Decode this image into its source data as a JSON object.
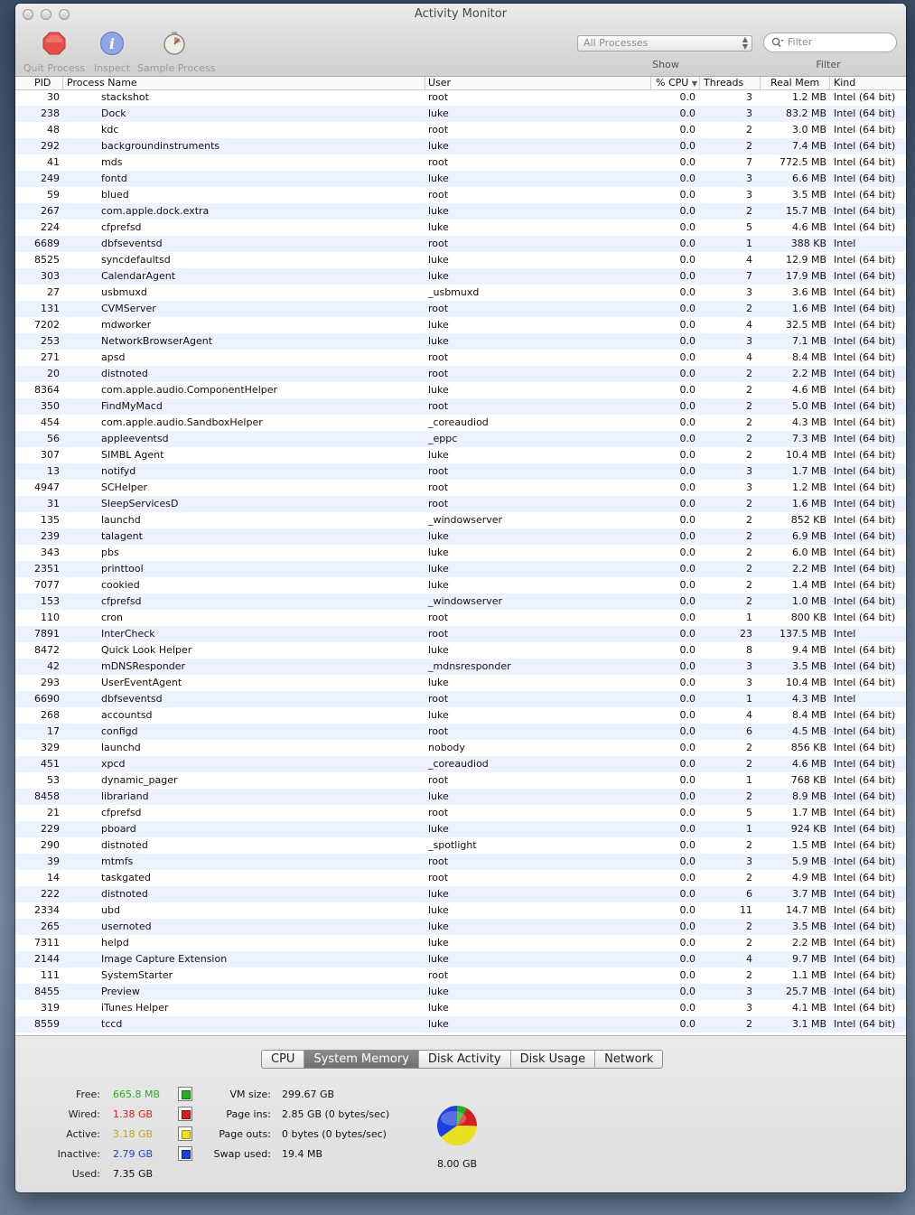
{
  "window": {
    "title": "Activity Monitor"
  },
  "toolbar": {
    "quit_label": "Quit Process",
    "inspect_label": "Inspect",
    "sample_label": "Sample Process",
    "show_label": "Show",
    "filter_label": "Filter",
    "show_value": "All Processes",
    "filter_placeholder": "Filter"
  },
  "columns": {
    "pid": "PID",
    "name": "Process Name",
    "user": "User",
    "cpu": "% CPU",
    "threads": "Threads",
    "mem": "Real Mem",
    "kind": "Kind"
  },
  "processes": [
    [
      "30",
      "stackshot",
      "root",
      "0.0",
      "3",
      "1.2 MB",
      "Intel (64 bit)"
    ],
    [
      "238",
      "Dock",
      "luke",
      "0.0",
      "3",
      "83.2 MB",
      "Intel (64 bit)"
    ],
    [
      "48",
      "kdc",
      "root",
      "0.0",
      "2",
      "3.0 MB",
      "Intel (64 bit)"
    ],
    [
      "292",
      "backgroundinstruments",
      "luke",
      "0.0",
      "2",
      "7.4 MB",
      "Intel (64 bit)"
    ],
    [
      "41",
      "mds",
      "root",
      "0.0",
      "7",
      "772.5 MB",
      "Intel (64 bit)"
    ],
    [
      "249",
      "fontd",
      "luke",
      "0.0",
      "3",
      "6.6 MB",
      "Intel (64 bit)"
    ],
    [
      "59",
      "blued",
      "root",
      "0.0",
      "3",
      "3.5 MB",
      "Intel (64 bit)"
    ],
    [
      "267",
      "com.apple.dock.extra",
      "luke",
      "0.0",
      "2",
      "15.7 MB",
      "Intel (64 bit)"
    ],
    [
      "224",
      "cfprefsd",
      "luke",
      "0.0",
      "5",
      "4.6 MB",
      "Intel (64 bit)"
    ],
    [
      "6689",
      "dbfseventsd",
      "root",
      "0.0",
      "1",
      "388 KB",
      "Intel"
    ],
    [
      "8525",
      "syncdefaultsd",
      "luke",
      "0.0",
      "4",
      "12.9 MB",
      "Intel (64 bit)"
    ],
    [
      "303",
      "CalendarAgent",
      "luke",
      "0.0",
      "7",
      "17.9 MB",
      "Intel (64 bit)"
    ],
    [
      "27",
      "usbmuxd",
      "_usbmuxd",
      "0.0",
      "3",
      "3.6 MB",
      "Intel (64 bit)"
    ],
    [
      "131",
      "CVMServer",
      "root",
      "0.0",
      "2",
      "1.6 MB",
      "Intel (64 bit)"
    ],
    [
      "7202",
      "mdworker",
      "luke",
      "0.0",
      "4",
      "32.5 MB",
      "Intel (64 bit)"
    ],
    [
      "253",
      "NetworkBrowserAgent",
      "luke",
      "0.0",
      "3",
      "7.1 MB",
      "Intel (64 bit)"
    ],
    [
      "271",
      "apsd",
      "root",
      "0.0",
      "4",
      "8.4 MB",
      "Intel (64 bit)"
    ],
    [
      "20",
      "distnoted",
      "root",
      "0.0",
      "2",
      "2.2 MB",
      "Intel (64 bit)"
    ],
    [
      "8364",
      "com.apple.audio.ComponentHelper",
      "luke",
      "0.0",
      "2",
      "4.6 MB",
      "Intel (64 bit)"
    ],
    [
      "350",
      "FindMyMacd",
      "root",
      "0.0",
      "2",
      "5.0 MB",
      "Intel (64 bit)"
    ],
    [
      "454",
      "com.apple.audio.SandboxHelper",
      "_coreaudiod",
      "0.0",
      "2",
      "4.3 MB",
      "Intel (64 bit)"
    ],
    [
      "56",
      "appleeventsd",
      "_eppc",
      "0.0",
      "2",
      "7.3 MB",
      "Intel (64 bit)"
    ],
    [
      "307",
      "SIMBL Agent",
      "luke",
      "0.0",
      "2",
      "10.4 MB",
      "Intel (64 bit)"
    ],
    [
      "13",
      "notifyd",
      "root",
      "0.0",
      "3",
      "1.7 MB",
      "Intel (64 bit)"
    ],
    [
      "4947",
      "SCHelper",
      "root",
      "0.0",
      "3",
      "1.2 MB",
      "Intel (64 bit)"
    ],
    [
      "31",
      "SleepServicesD",
      "root",
      "0.0",
      "2",
      "1.6 MB",
      "Intel (64 bit)"
    ],
    [
      "135",
      "launchd",
      "_windowserver",
      "0.0",
      "2",
      "852 KB",
      "Intel (64 bit)"
    ],
    [
      "239",
      "talagent",
      "luke",
      "0.0",
      "2",
      "6.9 MB",
      "Intel (64 bit)"
    ],
    [
      "343",
      "pbs",
      "luke",
      "0.0",
      "2",
      "6.0 MB",
      "Intel (64 bit)"
    ],
    [
      "2351",
      "printtool",
      "luke",
      "0.0",
      "2",
      "2.2 MB",
      "Intel (64 bit)"
    ],
    [
      "7077",
      "cookied",
      "luke",
      "0.0",
      "2",
      "1.4 MB",
      "Intel (64 bit)"
    ],
    [
      "153",
      "cfprefsd",
      "_windowserver",
      "0.0",
      "2",
      "1.0 MB",
      "Intel (64 bit)"
    ],
    [
      "110",
      "cron",
      "root",
      "0.0",
      "1",
      "800 KB",
      "Intel (64 bit)"
    ],
    [
      "7891",
      "InterCheck",
      "root",
      "0.0",
      "23",
      "137.5 MB",
      "Intel"
    ],
    [
      "8472",
      "Quick Look Helper",
      "luke",
      "0.0",
      "8",
      "9.4 MB",
      "Intel (64 bit)"
    ],
    [
      "42",
      "mDNSResponder",
      "_mdnsresponder",
      "0.0",
      "3",
      "3.5 MB",
      "Intel (64 bit)"
    ],
    [
      "293",
      "UserEventAgent",
      "luke",
      "0.0",
      "3",
      "10.4 MB",
      "Intel (64 bit)"
    ],
    [
      "6690",
      "dbfseventsd",
      "root",
      "0.0",
      "1",
      "4.3 MB",
      "Intel"
    ],
    [
      "268",
      "accountsd",
      "luke",
      "0.0",
      "4",
      "8.4 MB",
      "Intel (64 bit)"
    ],
    [
      "17",
      "configd",
      "root",
      "0.0",
      "6",
      "4.5 MB",
      "Intel (64 bit)"
    ],
    [
      "329",
      "launchd",
      "nobody",
      "0.0",
      "2",
      "856 KB",
      "Intel (64 bit)"
    ],
    [
      "451",
      "xpcd",
      "_coreaudiod",
      "0.0",
      "2",
      "4.6 MB",
      "Intel (64 bit)"
    ],
    [
      "53",
      "dynamic_pager",
      "root",
      "0.0",
      "1",
      "768 KB",
      "Intel (64 bit)"
    ],
    [
      "8458",
      "librariand",
      "luke",
      "0.0",
      "2",
      "8.9 MB",
      "Intel (64 bit)"
    ],
    [
      "21",
      "cfprefsd",
      "root",
      "0.0",
      "5",
      "1.7 MB",
      "Intel (64 bit)"
    ],
    [
      "229",
      "pboard",
      "luke",
      "0.0",
      "1",
      "924 KB",
      "Intel (64 bit)"
    ],
    [
      "290",
      "distnoted",
      "_spotlight",
      "0.0",
      "2",
      "1.5 MB",
      "Intel (64 bit)"
    ],
    [
      "39",
      "mtmfs",
      "root",
      "0.0",
      "3",
      "5.9 MB",
      "Intel (64 bit)"
    ],
    [
      "14",
      "taskgated",
      "root",
      "0.0",
      "2",
      "4.9 MB",
      "Intel (64 bit)"
    ],
    [
      "222",
      "distnoted",
      "luke",
      "0.0",
      "6",
      "3.7 MB",
      "Intel (64 bit)"
    ],
    [
      "2334",
      "ubd",
      "luke",
      "0.0",
      "11",
      "14.7 MB",
      "Intel (64 bit)"
    ],
    [
      "265",
      "usernoted",
      "luke",
      "0.0",
      "2",
      "3.5 MB",
      "Intel (64 bit)"
    ],
    [
      "7311",
      "helpd",
      "luke",
      "0.0",
      "2",
      "2.2 MB",
      "Intel (64 bit)"
    ],
    [
      "2144",
      "Image Capture Extension",
      "luke",
      "0.0",
      "4",
      "9.7 MB",
      "Intel (64 bit)"
    ],
    [
      "111",
      "SystemStarter",
      "root",
      "0.0",
      "2",
      "1.1 MB",
      "Intel (64 bit)"
    ],
    [
      "8455",
      "Preview",
      "luke",
      "0.0",
      "3",
      "25.7 MB",
      "Intel (64 bit)"
    ],
    [
      "319",
      "iTunes Helper",
      "luke",
      "0.0",
      "3",
      "4.1 MB",
      "Intel (64 bit)"
    ],
    [
      "8559",
      "tccd",
      "luke",
      "0.0",
      "2",
      "3.1 MB",
      "Intel (64 bit)"
    ]
  ],
  "tabs": [
    "CPU",
    "System Memory",
    "Disk Activity",
    "Disk Usage",
    "Network"
  ],
  "memory": {
    "free_label": "Free:",
    "free_value": "665.8 MB",
    "free_color": "#22b022",
    "wired_label": "Wired:",
    "wired_value": "1.38 GB",
    "wired_color": "#d42020",
    "active_label": "Active:",
    "active_value": "3.18 GB",
    "active_color": "#e8e020",
    "inactive_label": "Inactive:",
    "inactive_value": "2.79 GB",
    "inactive_color": "#1e3fe0",
    "used_label": "Used:",
    "used_value": "7.35 GB",
    "vm_size_label": "VM size:",
    "vm_size_value": "299.67 GB",
    "page_ins_label": "Page ins:",
    "page_ins_value": "2.85 GB (0 bytes/sec)",
    "page_outs_label": "Page outs:",
    "page_outs_value": "0 bytes (0 bytes/sec)",
    "swap_label": "Swap used:",
    "swap_value": "19.4 MB",
    "total": "8.00 GB"
  }
}
